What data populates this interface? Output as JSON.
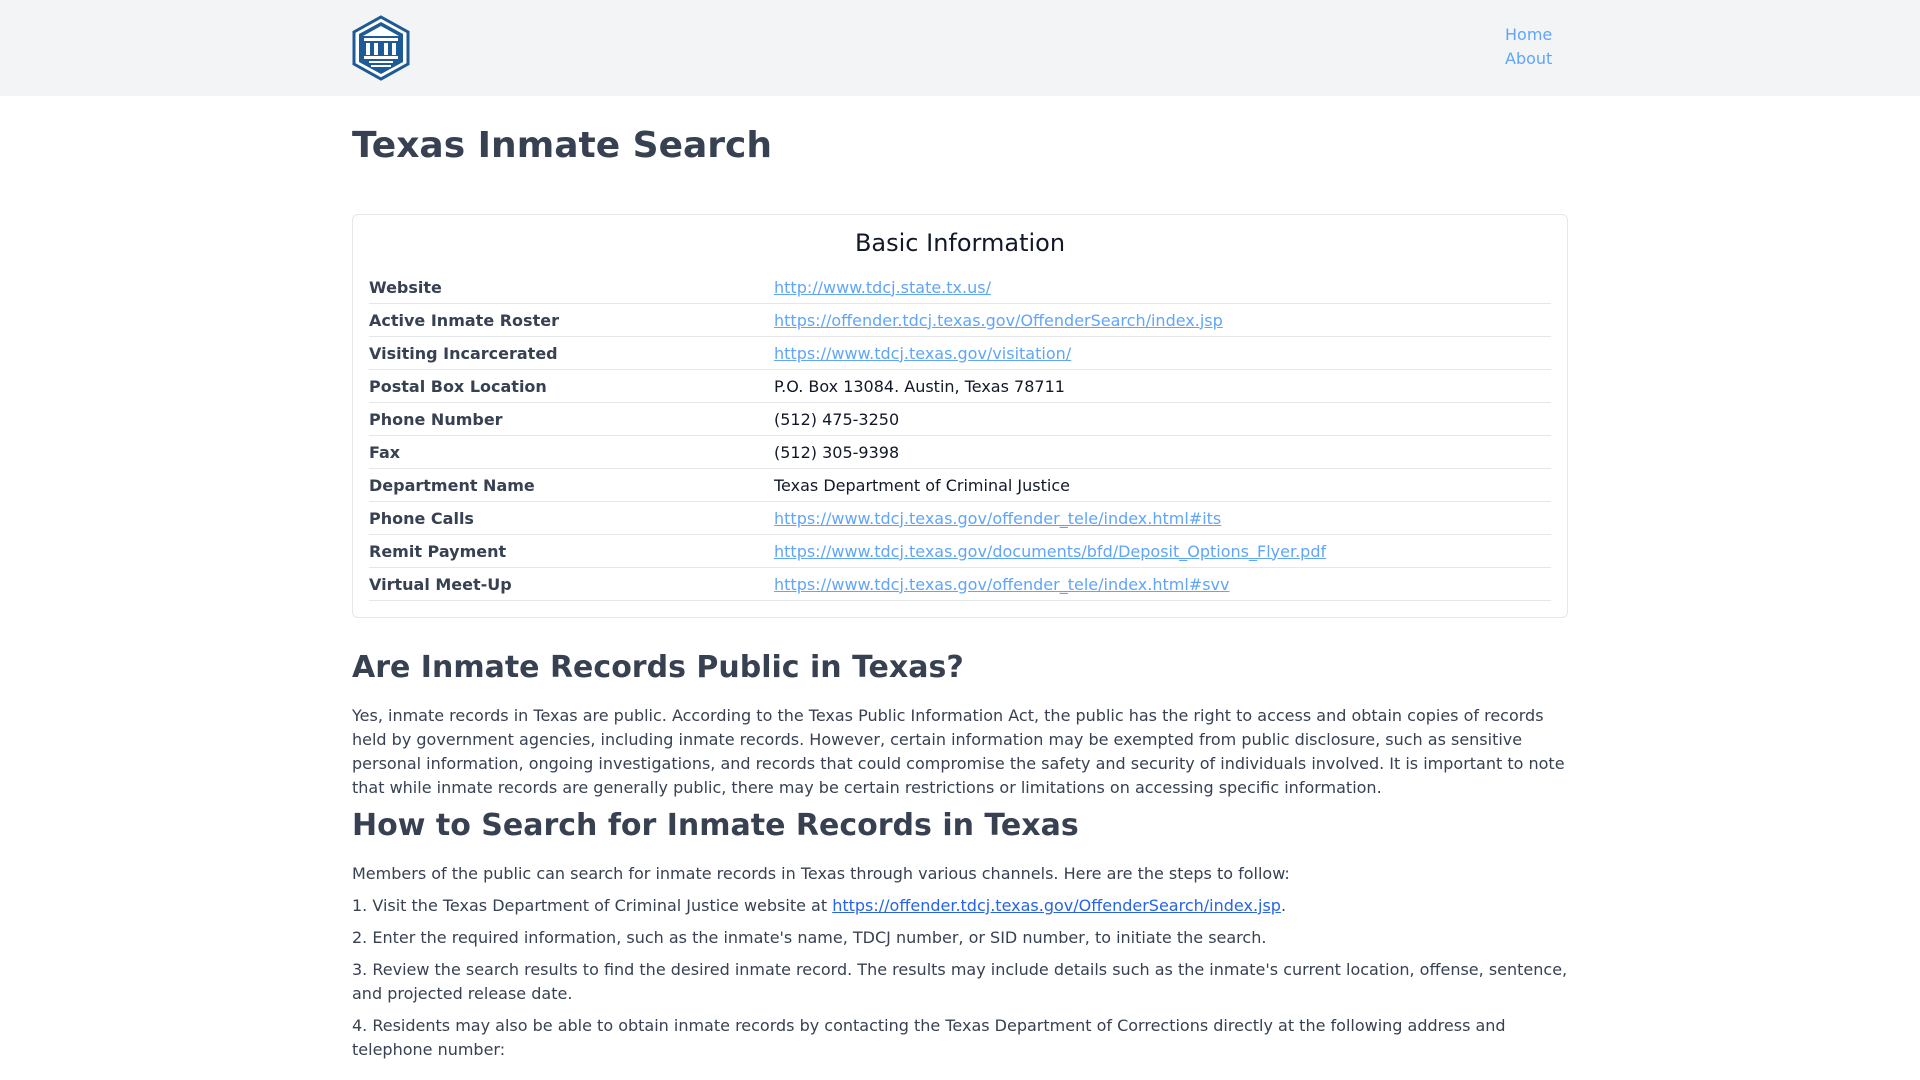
{
  "header": {
    "logo_name": "county-seal-logo",
    "nav": [
      {
        "label": "Home"
      },
      {
        "label": "About"
      }
    ]
  },
  "page": {
    "title": "Texas Inmate Search"
  },
  "basic_info": {
    "title": "Basic Information",
    "rows": [
      {
        "label": "Website",
        "value": "http://www.tdcj.state.tx.us/",
        "link": true
      },
      {
        "label": "Active Inmate Roster",
        "value": "https://offender.tdcj.texas.gov/OffenderSearch/index.jsp",
        "link": true
      },
      {
        "label": "Visiting Incarcerated",
        "value": "https://www.tdcj.texas.gov/visitation/",
        "link": true
      },
      {
        "label": "Postal Box Location",
        "value": "P.O. Box 13084. Austin, Texas 78711",
        "link": false
      },
      {
        "label": "Phone Number",
        "value": "(512) 475-3250",
        "link": false
      },
      {
        "label": "Fax",
        "value": "(512) 305-9398",
        "link": false
      },
      {
        "label": "Department Name",
        "value": "Texas Department of Criminal Justice",
        "link": false
      },
      {
        "label": "Phone Calls",
        "value": "https://www.tdcj.texas.gov/offender_tele/index.html#its",
        "link": true
      },
      {
        "label": "Remit Payment",
        "value": "https://www.tdcj.texas.gov/documents/bfd/Deposit_Options_Flyer.pdf",
        "link": true
      },
      {
        "label": "Virtual Meet-Up",
        "value": "https://www.tdcj.texas.gov/offender_tele/index.html#svv",
        "link": true
      }
    ]
  },
  "public_section": {
    "heading": "Are Inmate Records Public in Texas?",
    "text": "Yes, inmate records in Texas are public. According to the Texas Public Information Act, the public has the right to access and obtain copies of records held by government agencies, including inmate records. However, certain information may be exempted from public disclosure, such as sensitive personal information, ongoing investigations, and records that could compromise the safety and security of individuals involved. It is important to note that while inmate records are generally public, there may be certain restrictions or limitations on accessing specific information."
  },
  "search_section": {
    "heading": "How to Search for Inmate Records in Texas",
    "intro": "Members of the public can search for inmate records in Texas through various channels. Here are the steps to follow:",
    "step1_prefix": "1. Visit the Texas Department of Criminal Justice website at ",
    "step1_link": "https://offender.tdcj.texas.gov/OffenderSearch/index.jsp",
    "step1_suffix": ".",
    "step2": "2. Enter the required information, such as the inmate's name, TDCJ number, or SID number, to initiate the search.",
    "step3": "3. Review the search results to find the desired inmate record. The results may include details such as the inmate's current location, offense, sentence, and projected release date.",
    "step4": "4. Residents may also be able to obtain inmate records by contacting the Texas Department of Corrections directly at the following address and telephone number:"
  }
}
